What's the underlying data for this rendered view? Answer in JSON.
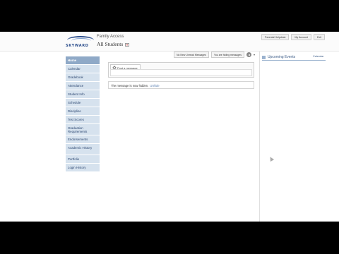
{
  "header": {
    "logo_text": "SKYWARD",
    "app_title": "Family Access",
    "student_selector": "All Students",
    "top_links": [
      "Parental Helpdesk",
      "My Account",
      "Exit"
    ]
  },
  "nav": {
    "items": [
      {
        "label": "Home",
        "active": true
      },
      {
        "label": "Calendar"
      },
      {
        "label": "Gradebook"
      },
      {
        "label": "Attendance"
      },
      {
        "label": "Student Info"
      },
      {
        "label": "Schedule"
      },
      {
        "label": "Discipline"
      },
      {
        "label": "Test Scores"
      },
      {
        "label": "Graduation Requirements"
      },
      {
        "label": "Endorsements"
      },
      {
        "label": "Academic History"
      },
      {
        "label": "Portfolio"
      },
      {
        "label": "Login History"
      }
    ]
  },
  "main": {
    "toolbar": {
      "unread_button": "No New Unread Messages",
      "hiding_button": "You are hiding messages"
    },
    "post_tab_label": "Post a message",
    "hidden_message_text": "The message is now hidden.",
    "unhide_link": "Unhide"
  },
  "right_panel": {
    "events_title": "Upcoming Events",
    "calendar_link": "Calendar"
  }
}
